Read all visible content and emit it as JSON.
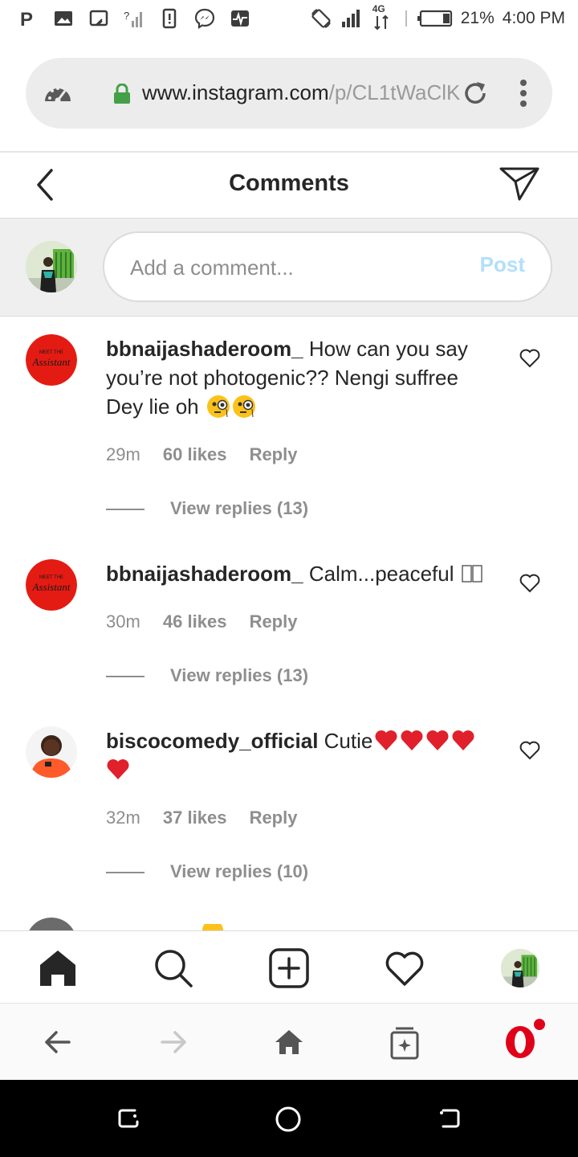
{
  "status_bar": {
    "battery": "21%",
    "time": "4:00 PM",
    "network": "4G"
  },
  "browser": {
    "url_host": "www.instagram.com",
    "url_path": "/p/CL1tWaClK"
  },
  "header": {
    "title": "Comments"
  },
  "composer": {
    "placeholder": "Add a comment...",
    "post_label": "Post"
  },
  "comments": [
    {
      "username": "bbnaijashaderoom_",
      "text": "How can you say you’re not photogenic?? Nengi suffree Dey lie oh",
      "time": "29m",
      "likes": "60 likes",
      "reply": "Reply",
      "view_replies": "View replies (13)"
    },
    {
      "username": "bbnaijashaderoom_",
      "text": "Calm...peaceful",
      "time": "30m",
      "likes": "46 likes",
      "reply": "Reply",
      "view_replies": "View replies (13)"
    },
    {
      "username": "biscocomedy_official",
      "text": "Cutie",
      "time": "32m",
      "likes": "37 likes",
      "reply": "Reply",
      "view_replies": "View replies (10)"
    }
  ],
  "avatar_labels": {
    "shaderoom_logo_top": "MEET THE",
    "shaderoom_logo_main": "Assistant"
  },
  "colors": {
    "accent_blue_disabled": "#b2dffc",
    "heart_red": "#e0202b",
    "opera_red": "#e0001a",
    "text_primary": "#262626",
    "text_secondary": "#8e8e8e"
  }
}
